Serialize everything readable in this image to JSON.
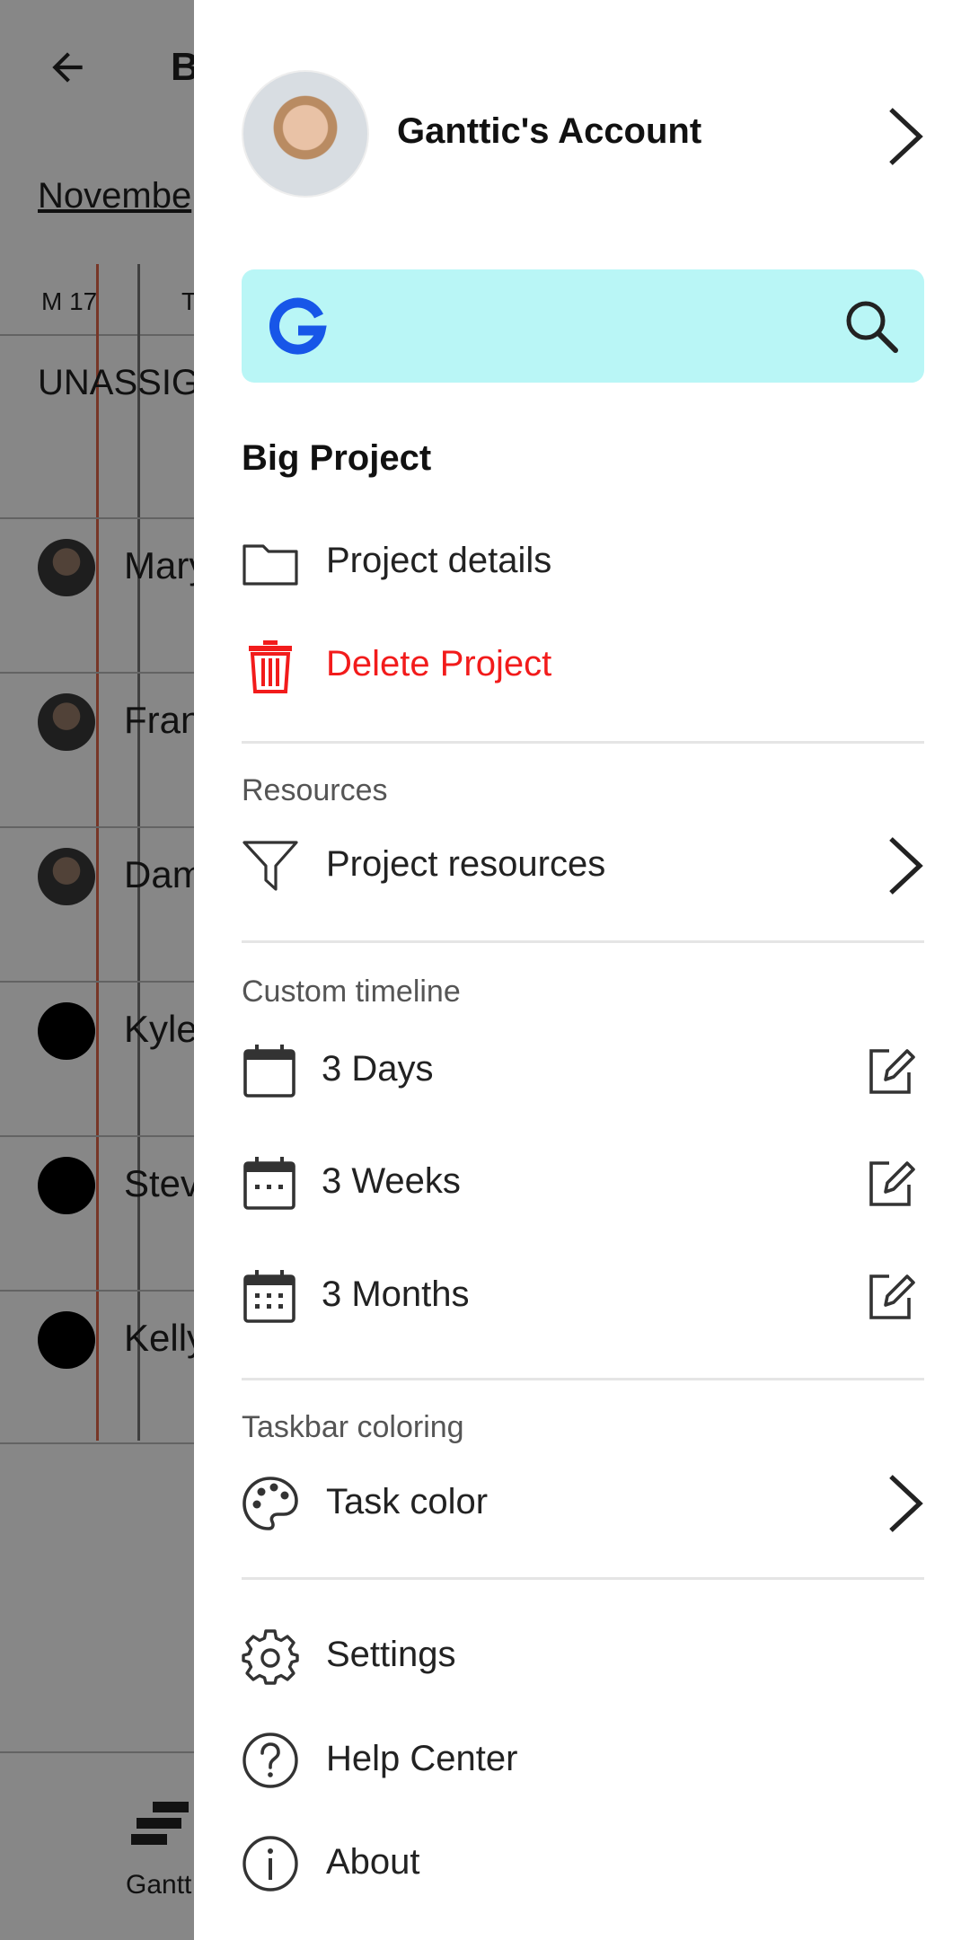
{
  "background": {
    "title": "B",
    "month": "Novembe",
    "days": [
      "M 17",
      "T"
    ],
    "unassigned": "UNASSIG",
    "rows": [
      {
        "name": "Mary",
        "photo": true
      },
      {
        "name": "Fran",
        "photo": true
      },
      {
        "name": "Dam",
        "photo": true
      },
      {
        "name": "Kyle",
        "photo": false
      },
      {
        "name": "Stev",
        "photo": false
      },
      {
        "name": "Kelly",
        "photo": false
      }
    ],
    "bottom_tab": "Gantt"
  },
  "drawer": {
    "account": {
      "name": "Ganttic's Account"
    },
    "search": {
      "logo": "ganttic-g-icon",
      "icon": "search-icon"
    },
    "project": {
      "title": "Big Project",
      "details_label": "Project details",
      "delete_label": "Delete Project"
    },
    "resources": {
      "caption": "Resources",
      "item_label": "Project resources"
    },
    "timeline": {
      "caption": "Custom timeline",
      "items": [
        {
          "label": "3 Days"
        },
        {
          "label": "3 Weeks"
        },
        {
          "label": "3 Months"
        }
      ]
    },
    "coloring": {
      "caption": "Taskbar coloring",
      "item_label": "Task color"
    },
    "footer": {
      "settings_label": "Settings",
      "help_label": "Help Center",
      "about_label": "About"
    }
  },
  "colors": {
    "danger": "#f21b1b",
    "search_bg": "#b9f6f6",
    "brand_blue": "#1756e8",
    "scrim": "rgba(0,0,0,0.47)"
  }
}
